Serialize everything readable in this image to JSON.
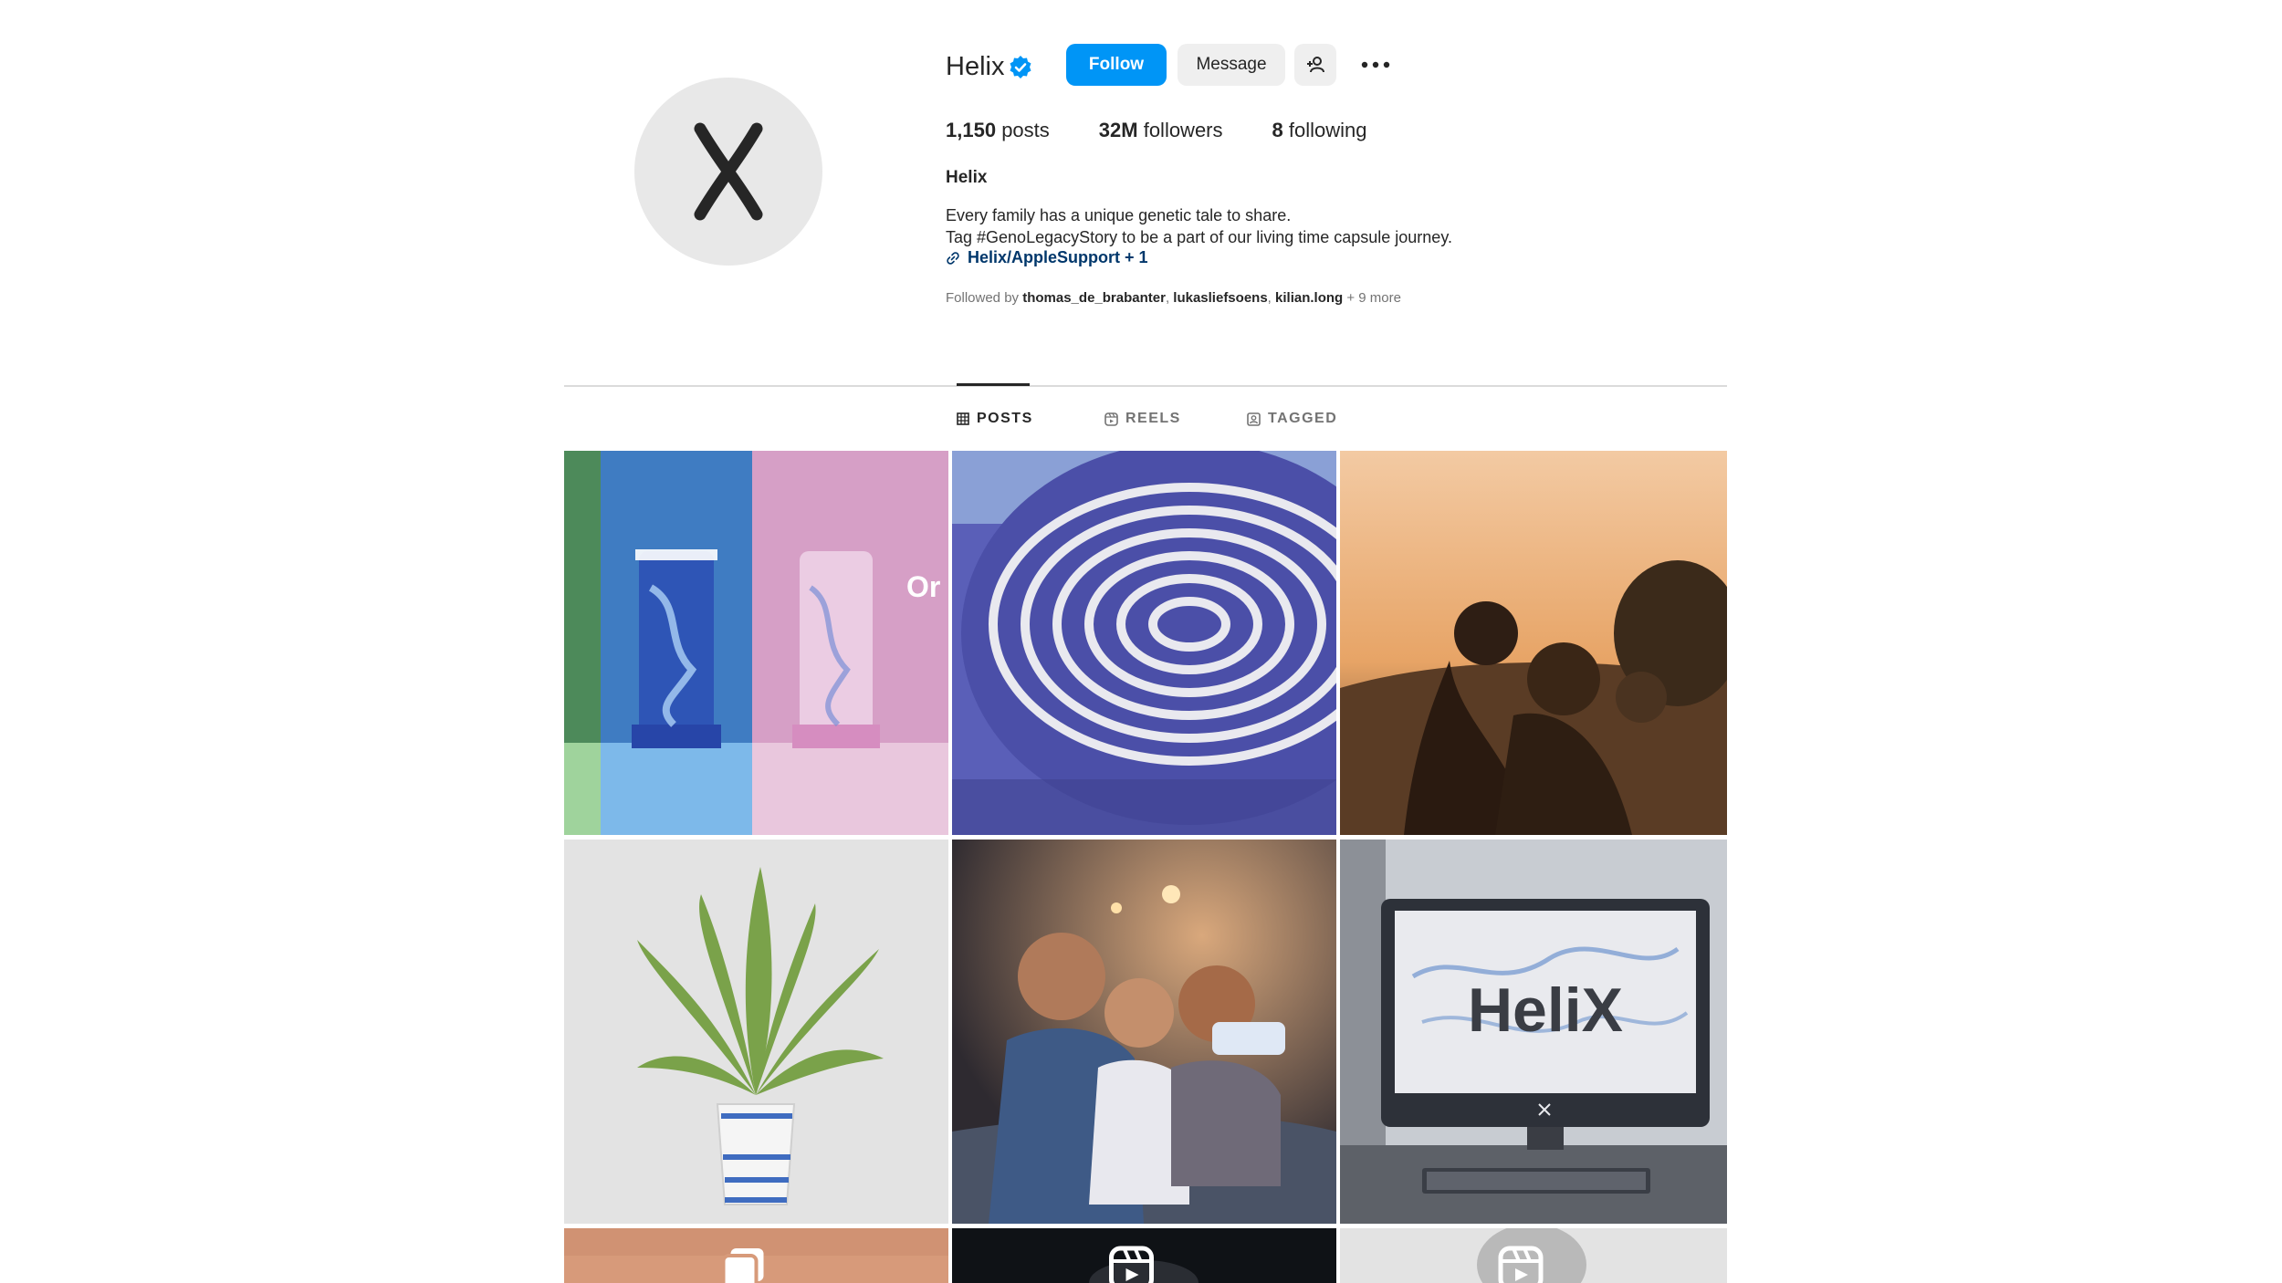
{
  "profile": {
    "username": "Helix",
    "verified": true,
    "follow_label": "Follow",
    "message_label": "Message",
    "stats": {
      "posts_count": "1,150",
      "posts_label": "posts",
      "followers_count": "32M",
      "followers_label": "followers",
      "following_count": "8",
      "following_label": "following"
    },
    "full_name": "Helix",
    "bio_line1": "Every family has a unique genetic tale to share.",
    "bio_line2": "Tag #GenoLegacyStory to be a part of our living time capsule journey.",
    "link_text": "Helix/AppleSupport + 1",
    "followed_by_prefix": "Followed by",
    "followed_by_users": [
      "thomas_de_brabanter",
      "lukasliefsoens",
      "kilian.long"
    ],
    "followed_by_more": "+ 9 more"
  },
  "tabs": [
    {
      "label": "POSTS",
      "icon": "grid-icon",
      "active": true
    },
    {
      "label": "REELS",
      "icon": "reels-icon",
      "active": false
    },
    {
      "label": "TAGGED",
      "icon": "tagged-icon",
      "active": false
    }
  ],
  "posts": [
    {
      "name": "post-tube-product",
      "text": "Or new"
    },
    {
      "name": "post-fingerprint"
    },
    {
      "name": "post-family-sunset"
    },
    {
      "name": "post-plant-pot"
    },
    {
      "name": "post-family-couch"
    },
    {
      "name": "post-monitor-helix",
      "text": "HeliX"
    },
    {
      "name": "post-skin-closeup",
      "badge": "carousel-icon"
    },
    {
      "name": "post-dark-reel",
      "badge": "reel-icon"
    },
    {
      "name": "post-gray-reel",
      "badge": "reel-icon"
    }
  ],
  "colors": {
    "accent": "#0095f6",
    "link": "#00376b",
    "text": "#262626",
    "muted": "#737373"
  }
}
